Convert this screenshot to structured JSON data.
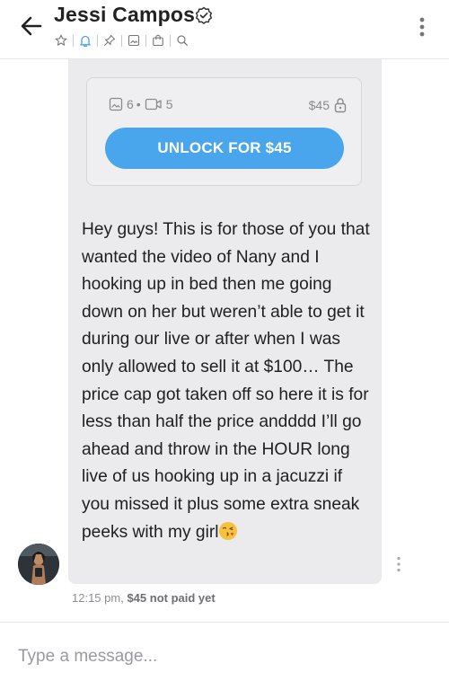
{
  "header": {
    "title": "Jessi Campos",
    "icons": [
      "back-arrow-icon",
      "verified-icon",
      "star-icon",
      "bell-icon",
      "pin-icon",
      "image-icon",
      "bag-icon",
      "search-icon",
      "more-vertical-icon"
    ]
  },
  "message": {
    "locked_media": {
      "photos_count": "6",
      "separator": "•",
      "videos_count": "5",
      "price": "$45",
      "unlock_label": "UNLOCK FOR $45"
    },
    "text": "Hey guys! This is for those of you that wanted the video of Nany and I hooking up in bed then me going down on her but weren’t able to get it during our live or after when I was only allowed to sell it at $100… The price cap got taken off so here it is for less than half the price andddd I’ll go ahead and throw in the HOUR long live of us hooking up in a jacuzzi if you missed it plus some extra sneak peeks with my girl",
    "time": "12:15 pm,",
    "status": "$45 not paid yet"
  },
  "composer": {
    "placeholder": "Type a message..."
  },
  "colors": {
    "accent": "#4aa6ec",
    "bubble": "#ebebed",
    "muted": "#8e8e93"
  }
}
